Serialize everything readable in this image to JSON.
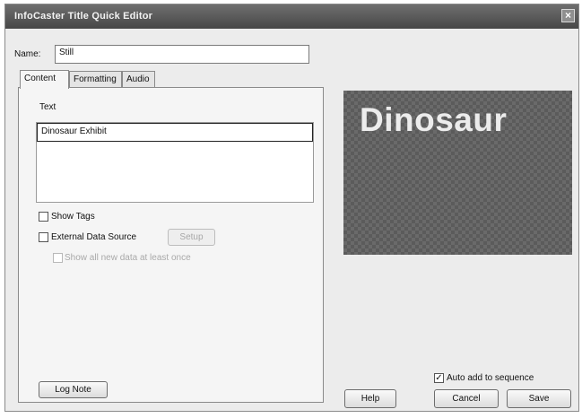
{
  "window": {
    "title": "InfoCaster Title Quick Editor",
    "close_label": "×"
  },
  "name_field": {
    "label": "Name:",
    "value": "Still"
  },
  "tabs": [
    {
      "label": "Content",
      "active": true
    },
    {
      "label": "Formatting",
      "active": false
    },
    {
      "label": "Audio",
      "active": false
    }
  ],
  "content": {
    "text_label": "Text",
    "text_value": "Dinosaur Exhibit",
    "show_tags_label": "Show Tags",
    "external_source_label": "External Data Source",
    "setup_label": "Setup",
    "show_all_label": "Show all new data at least once",
    "log_note_label": "Log Note"
  },
  "preview": {
    "text": "Dinosaur"
  },
  "footer": {
    "auto_add_label": "Auto add to sequence",
    "auto_add_checked": true,
    "help_label": "Help",
    "cancel_label": "Cancel",
    "save_label": "Save"
  }
}
